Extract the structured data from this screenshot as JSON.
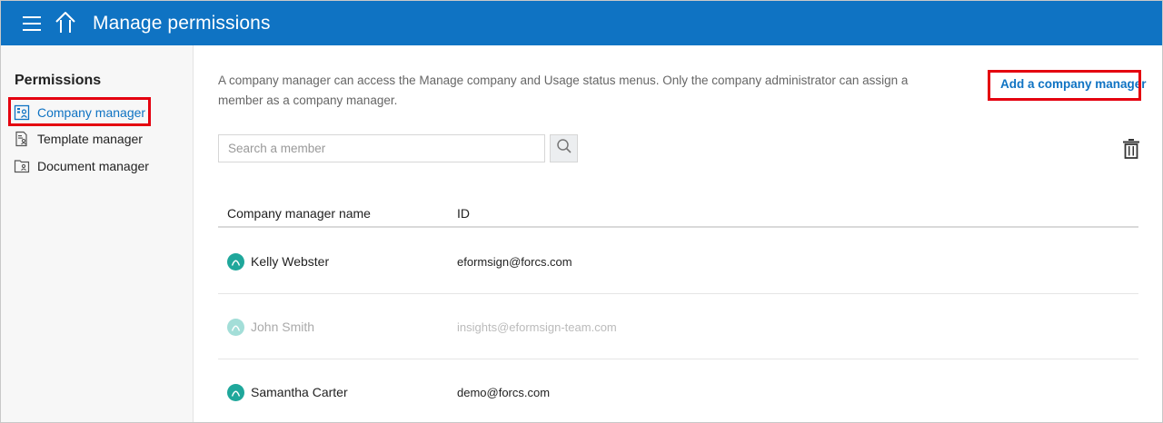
{
  "header": {
    "title": "Manage permissions",
    "menu_icon": "hamburger-menu-icon",
    "home_icon": "home-icon",
    "bg_color": "#0f73c3"
  },
  "sidebar": {
    "title": "Permissions",
    "items": [
      {
        "label": "Company manager",
        "icon": "company-manager-icon",
        "active": true
      },
      {
        "label": "Template manager",
        "icon": "template-manager-icon",
        "active": false
      },
      {
        "label": "Document manager",
        "icon": "document-manager-icon",
        "active": false
      }
    ]
  },
  "main": {
    "description": "A company manager can access the Manage company and Usage status menus. Only the company administrator can assign a member as a company manager.",
    "add_button_label": "Add a company manager",
    "search": {
      "placeholder": "Search a member",
      "value": ""
    },
    "table": {
      "headers": [
        "Company manager name",
        "ID"
      ],
      "rows": [
        {
          "name": "Kelly Webster",
          "id": "eformsign@forcs.com",
          "disabled": false
        },
        {
          "name": "John Smith",
          "id": "insights@eformsign-team.com",
          "disabled": true
        },
        {
          "name": "Samantha Carter",
          "id": "demo@forcs.com",
          "disabled": false
        }
      ]
    }
  },
  "highlight_color": "#e4000f",
  "accent_color": "#0f73c3",
  "avatar_color": "#1fa79b"
}
